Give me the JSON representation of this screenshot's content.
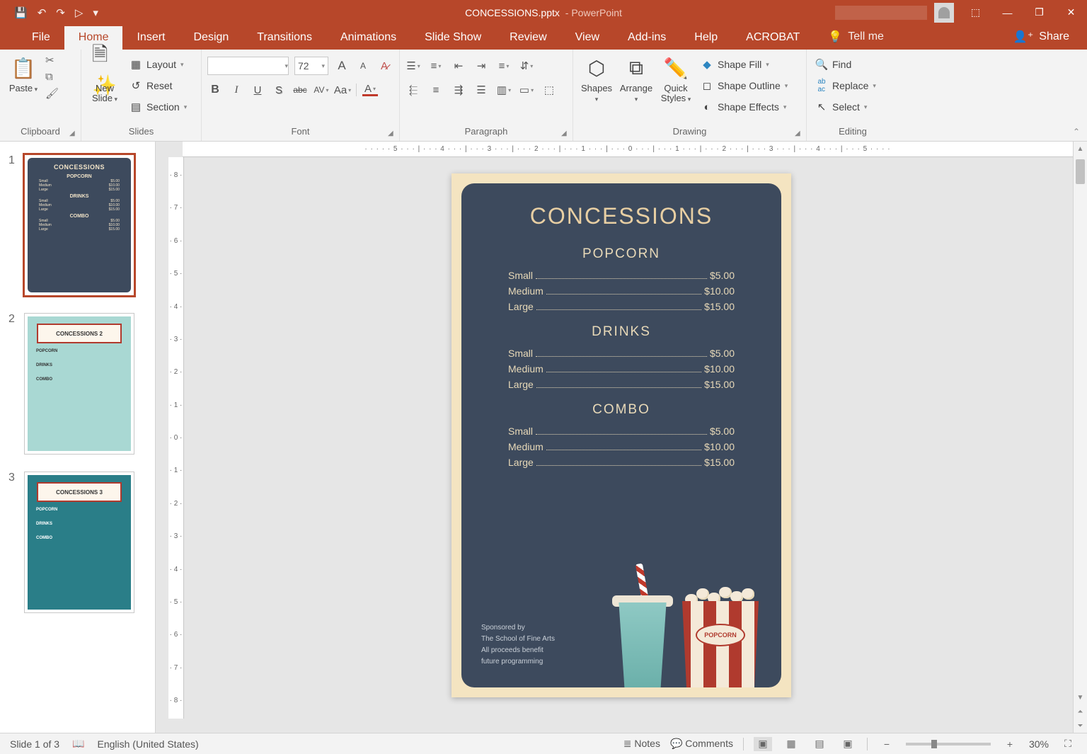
{
  "title": {
    "doc": "CONCESSIONS.pptx",
    "app": "PowerPoint"
  },
  "qat": {
    "save": "💾",
    "undo": "↶",
    "redo": "↷",
    "start": "▷",
    "more": "▾"
  },
  "win": {
    "ribbon_opts": "⬚",
    "minimize": "—",
    "restore": "❐",
    "close": "✕"
  },
  "tabs": {
    "file": "File",
    "home": "Home",
    "insert": "Insert",
    "design": "Design",
    "transitions": "Transitions",
    "animations": "Animations",
    "slideshow": "Slide Show",
    "review": "Review",
    "view": "View",
    "addins": "Add-ins",
    "help": "Help",
    "acrobat": "ACROBAT",
    "tellme": "Tell me",
    "share": "Share"
  },
  "ribbon": {
    "clipboard": {
      "label": "Clipboard",
      "paste": "Paste",
      "cut": "✂",
      "copy": "⧉",
      "painter": "🖌"
    },
    "slides": {
      "label": "Slides",
      "newslide": "New\nSlide",
      "layout": "Layout",
      "reset": "Reset",
      "section": "Section"
    },
    "font": {
      "label": "Font",
      "fontname": "",
      "fontsize": "72",
      "grow": "A",
      "shrink": "A",
      "clear": "A",
      "bold": "B",
      "italic": "I",
      "underline": "U",
      "shadow": "S",
      "strike": "abc",
      "spacing": "AV",
      "case": "Aa",
      "color": "A"
    },
    "paragraph": {
      "label": "Paragraph"
    },
    "drawing": {
      "label": "Drawing",
      "shapes": "Shapes",
      "arrange": "Arrange",
      "quick": "Quick\nStyles",
      "fill": "Shape Fill",
      "outline": "Shape Outline",
      "effects": "Shape Effects"
    },
    "editing": {
      "label": "Editing",
      "find": "Find",
      "replace": "Replace",
      "select": "Select"
    }
  },
  "slide": {
    "title": "CONCESSIONS",
    "sections": [
      {
        "name": "POPCORN",
        "items": [
          {
            "label": "Small",
            "price": "$5.00"
          },
          {
            "label": "Medium",
            "price": "$10.00"
          },
          {
            "label": "Large",
            "price": "$15.00"
          }
        ]
      },
      {
        "name": "DRINKS",
        "items": [
          {
            "label": "Small",
            "price": "$5.00"
          },
          {
            "label": "Medium",
            "price": "$10.00"
          },
          {
            "label": "Large",
            "price": "$15.00"
          }
        ]
      },
      {
        "name": "COMBO",
        "items": [
          {
            "label": "Small",
            "price": "$5.00"
          },
          {
            "label": "Medium",
            "price": "$10.00"
          },
          {
            "label": "Large",
            "price": "$15.00"
          }
        ]
      }
    ],
    "sponsor": [
      "Sponsored by",
      "The School of Fine Arts",
      "All proceeds benefit",
      "future programming"
    ],
    "popcorn_label": "POPCORN"
  },
  "thumbs": {
    "t1": {
      "num": "1",
      "title": "CONCESSIONS"
    },
    "t2": {
      "num": "2",
      "title": "CONCESSIONS 2"
    },
    "t3": {
      "num": "3",
      "title": "CONCESSIONS 3"
    },
    "sec_popcorn": "POPCORN",
    "sec_drinks": "DRINKS",
    "sec_combo": "COMBO"
  },
  "status": {
    "slide": "Slide 1 of 3",
    "lang": "English (United States)",
    "notes": "Notes",
    "comments": "Comments",
    "zoom": "30%"
  }
}
